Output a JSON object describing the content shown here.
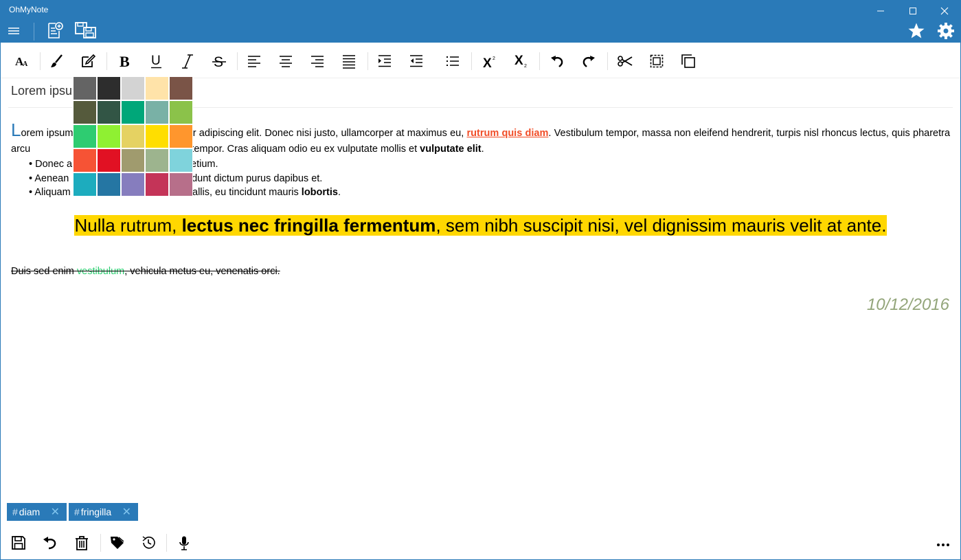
{
  "app": {
    "title": "OhMyNote"
  },
  "window_controls": [
    "minimize-icon",
    "maximize-icon",
    "close-icon"
  ],
  "header_icons": [
    "hamburger-menu-icon",
    "new-note-icon",
    "save-as-icon",
    "star-icon",
    "gear-icon"
  ],
  "toolbar_icons": [
    "font-size-icon",
    "brush-icon",
    "highlight-pen-icon",
    "bold-icon",
    "underline-icon",
    "italic-icon",
    "strikethrough-icon",
    "align-left-icon",
    "align-center-icon",
    "align-right-icon",
    "align-justify-icon",
    "indent-increase-icon",
    "indent-decrease-icon",
    "bulleted-list-icon",
    "superscript-icon",
    "subscript-icon",
    "undo-icon",
    "redo-icon",
    "cut-icon",
    "select-all-icon",
    "copy-icon"
  ],
  "note": {
    "title": "Lorem ipsum",
    "para1": {
      "dropcap": "L",
      "part1": "orem ipsum",
      "part2": "r adipiscing elit. Donec nisi justo, ullamcorper at maximus eu, ",
      "link": "rutrum quis diam",
      "part3": ". Vestibulum tempor, massa non eleifend hendrerit, turpis nisl rhoncus lectus, quis pharetra arcu",
      "part4": "s aliquet tempor. Cras aliquam odio eu ex vulputate mollis et ",
      "bold": "vulputate elit",
      "end": "."
    },
    "bullets": [
      {
        "a": "Donec a",
        "b": "pretium."
      },
      {
        "a": "Aenean",
        "b": "incidunt dictum purus dapibus et."
      },
      {
        "a": "Aliquam luctus lectus nec odio convallis, eu tincidunt mauris ",
        "bold": "lobortis",
        "end": "."
      }
    ],
    "highlight": {
      "pre": "Nulla rutrum, ",
      "bold": "lectus nec fringilla fermentum",
      "post": ", sem nibh suscipit nisi, vel dignissim mauris velit at ante."
    },
    "strike": {
      "pre": "Duis sed enim ",
      "green": "vestibulum",
      "post": ", vehicula metus eu, venenatis orci."
    },
    "date": "10/12/2016"
  },
  "colors": {
    "accent": "#2a7ab8",
    "link_red": "#f14d27",
    "highlight_yellow": "#ffd700",
    "date_green": "#93a57a",
    "palette": [
      "#646464",
      "#2d2d2d",
      "#d3d3d3",
      "#ffe3a9",
      "#7a5447",
      "#555a3c",
      "#325545",
      "#00a779",
      "#79b1a6",
      "#8bc24a",
      "#2ecc71",
      "#8ff032",
      "#e5d262",
      "#ffde00",
      "#ff962d",
      "#f65335",
      "#e11123",
      "#a09b6e",
      "#9db48e",
      "#7fd3dc",
      "#1dacbe",
      "#2576a3",
      "#867dbe",
      "#c43458",
      "#b76f8a"
    ]
  },
  "tags": [
    {
      "hash": "#",
      "label": "diam"
    },
    {
      "hash": "#",
      "label": "fringilla"
    }
  ],
  "bottom_icons": [
    "save-icon",
    "revert-icon",
    "delete-icon",
    "tag-icon",
    "history-icon",
    "microphone-icon",
    "more-icon"
  ]
}
